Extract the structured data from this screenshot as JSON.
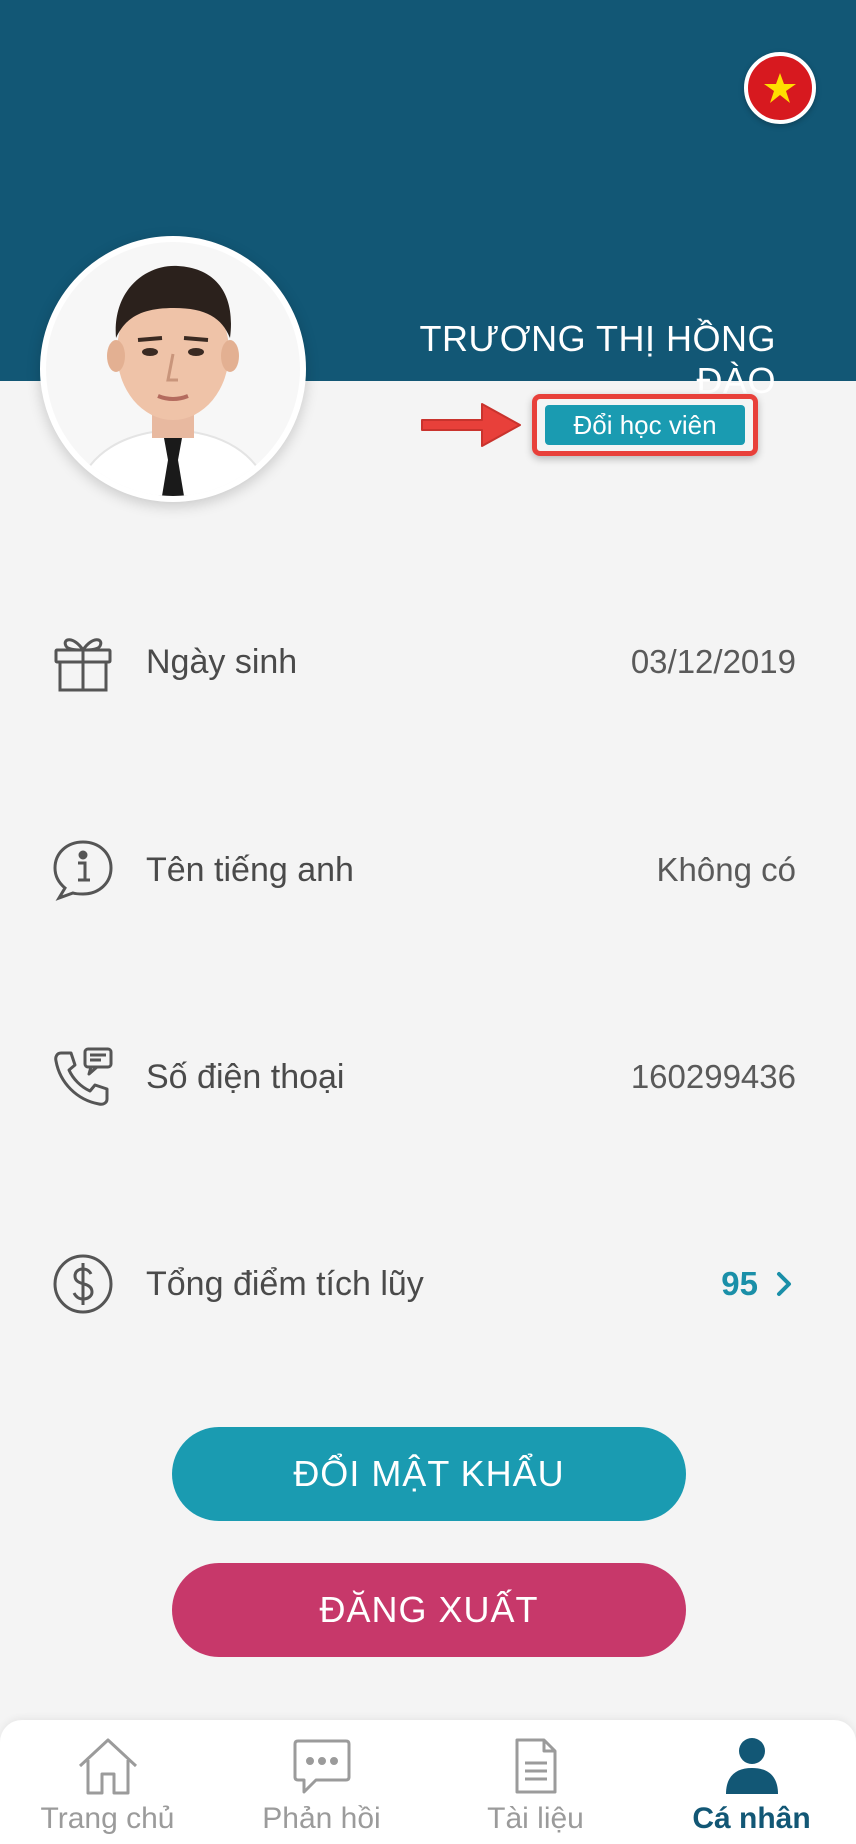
{
  "header": {
    "student_name": "TRƯƠNG THỊ HỒNG ĐÀO",
    "switch_student_label": "Đổi học viên",
    "flag_icon": "vietnam-flag-icon"
  },
  "info": [
    {
      "icon": "gift-icon",
      "label": "Ngày sinh",
      "value": "03/12/2019"
    },
    {
      "icon": "info-chat-icon",
      "label": "Tên tiếng anh",
      "value": "Không có"
    },
    {
      "icon": "phone-message-icon",
      "label": "Số điện thoại",
      "value": "160299436"
    },
    {
      "icon": "dollar-circle-icon",
      "label": "Tổng điểm tích lũy",
      "value": "95"
    }
  ],
  "buttons": {
    "change_password": "ĐỔI MẬT KHẨU",
    "logout": "ĐĂNG XUẤT"
  },
  "tabs": [
    {
      "icon": "home-icon",
      "label": "Trang chủ",
      "active": false
    },
    {
      "icon": "feedback-icon",
      "label": "Phản hồi",
      "active": false
    },
    {
      "icon": "document-icon",
      "label": "Tài liệu",
      "active": false
    },
    {
      "icon": "user-icon",
      "label": "Cá nhân",
      "active": true
    }
  ],
  "colors": {
    "header": "#125775",
    "accent": "#1a9bb1",
    "logout": "#c7386a",
    "highlight": "#e8403a"
  }
}
